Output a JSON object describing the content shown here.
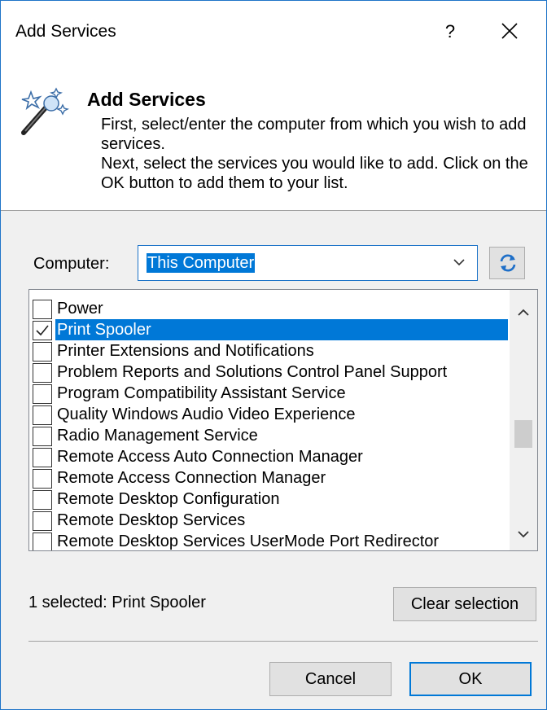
{
  "window": {
    "title": "Add Services",
    "help_label": "?"
  },
  "banner": {
    "title": "Add Services",
    "line1": "First, select/enter the computer from which you wish to add services.",
    "line2": "Next, select the services you would like to add. Click on the OK button to add them to your list.",
    "icon": "magic-wand-icon"
  },
  "computer": {
    "label": "Computer:",
    "value": "This Computer",
    "refresh_icon": "refresh-icon"
  },
  "services": [
    {
      "label": "Power",
      "checked": false,
      "selected": false
    },
    {
      "label": "Print Spooler",
      "checked": true,
      "selected": true
    },
    {
      "label": "Printer Extensions and Notifications",
      "checked": false,
      "selected": false
    },
    {
      "label": "Problem Reports and Solutions Control Panel Support",
      "checked": false,
      "selected": false
    },
    {
      "label": "Program Compatibility Assistant Service",
      "checked": false,
      "selected": false
    },
    {
      "label": "Quality Windows Audio Video Experience",
      "checked": false,
      "selected": false
    },
    {
      "label": "Radio Management Service",
      "checked": false,
      "selected": false
    },
    {
      "label": "Remote Access Auto Connection Manager",
      "checked": false,
      "selected": false
    },
    {
      "label": "Remote Access Connection Manager",
      "checked": false,
      "selected": false
    },
    {
      "label": "Remote Desktop Configuration",
      "checked": false,
      "selected": false
    },
    {
      "label": "Remote Desktop Services",
      "checked": false,
      "selected": false
    },
    {
      "label": "Remote Desktop Services UserMode Port Redirector",
      "checked": false,
      "selected": false
    }
  ],
  "footer": {
    "status": "1 selected: Print Spooler",
    "clear_label": "Clear selection",
    "cancel_label": "Cancel",
    "ok_label": "OK"
  },
  "colors": {
    "accent": "#0078d7",
    "border": "#1e74c8"
  }
}
